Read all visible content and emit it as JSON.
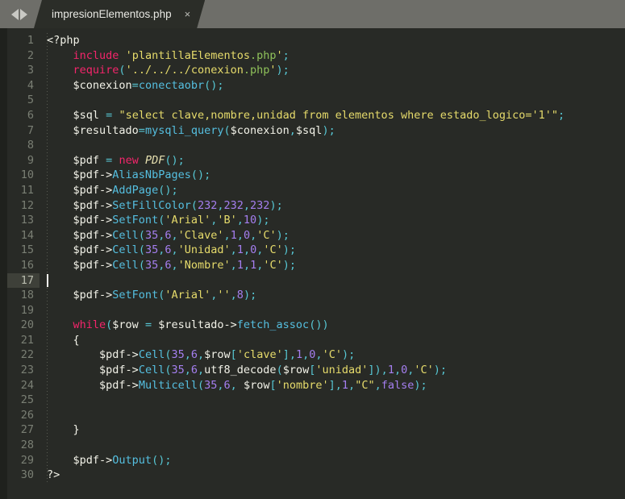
{
  "window": {
    "app": "code-editor",
    "theme_background": "#282a26",
    "tabbar_background": "#6e6e69"
  },
  "tabbar": {
    "nav_back_label": "◀",
    "nav_forward_label": "▶",
    "tabs": [
      {
        "title": "impresionElementos.php",
        "close_label": "×",
        "active": true
      }
    ]
  },
  "editor": {
    "language": "php",
    "active_line": 17,
    "total_lines": 30,
    "colors": {
      "keyword": "#f4256b",
      "string": "#e6db6b",
      "string_green": "#8fc15a",
      "number": "#a57ff0",
      "function": "#55bfe0",
      "operator": "#57c7d4",
      "variable": "#f2f2e8",
      "class": "#e6e0b0",
      "line_number": "#7a7f74",
      "active_line_bg": "#3e4039"
    },
    "line_numbers": [
      1,
      2,
      3,
      4,
      5,
      6,
      7,
      8,
      9,
      10,
      11,
      12,
      13,
      14,
      15,
      16,
      17,
      18,
      19,
      20,
      21,
      22,
      23,
      24,
      25,
      26,
      27,
      28,
      29,
      30
    ],
    "lines": [
      {
        "n": 1,
        "text": "<?php"
      },
      {
        "n": 2,
        "text": "    include 'plantillaElementos.php';"
      },
      {
        "n": 3,
        "text": "    require('../../../conexion.php');"
      },
      {
        "n": 4,
        "text": "    $conexion=conectaobr();"
      },
      {
        "n": 5,
        "text": ""
      },
      {
        "n": 6,
        "text": "    $sql = \"select clave,nombre,unidad from elementos where estado_logico='1'\";"
      },
      {
        "n": 7,
        "text": "    $resultado=mysqli_query($conexion,$sql);"
      },
      {
        "n": 8,
        "text": ""
      },
      {
        "n": 9,
        "text": "    $pdf = new PDF();"
      },
      {
        "n": 10,
        "text": "    $pdf->AliasNbPages();"
      },
      {
        "n": 11,
        "text": "    $pdf->AddPage();"
      },
      {
        "n": 12,
        "text": "    $pdf->SetFillColor(232,232,232);"
      },
      {
        "n": 13,
        "text": "    $pdf->SetFont('Arial','B',10);"
      },
      {
        "n": 14,
        "text": "    $pdf->Cell(35,6,'Clave',1,0,'C');"
      },
      {
        "n": 15,
        "text": "    $pdf->Cell(35,6,'Unidad',1,0,'C');"
      },
      {
        "n": 16,
        "text": "    $pdf->Cell(35,6,'Nombre',1,1,'C');"
      },
      {
        "n": 17,
        "text": ""
      },
      {
        "n": 18,
        "text": "    $pdf->SetFont('Arial','',8);"
      },
      {
        "n": 19,
        "text": ""
      },
      {
        "n": 20,
        "text": "    while($row = $resultado->fetch_assoc())"
      },
      {
        "n": 21,
        "text": "    {"
      },
      {
        "n": 22,
        "text": "        $pdf->Cell(35,6,$row['clave'],1,0,'C');"
      },
      {
        "n": 23,
        "text": "        $pdf->Cell(35,6,utf8_decode($row['unidad']),1,0,'C');"
      },
      {
        "n": 24,
        "text": "        $pdf->Multicell(35,6, $row['nombre'],1,\"C\",false);"
      },
      {
        "n": 25,
        "text": ""
      },
      {
        "n": 26,
        "text": ""
      },
      {
        "n": 27,
        "text": "    }"
      },
      {
        "n": 28,
        "text": ""
      },
      {
        "n": 29,
        "text": "    $pdf->Output();"
      },
      {
        "n": 30,
        "text": "?>"
      }
    ]
  }
}
